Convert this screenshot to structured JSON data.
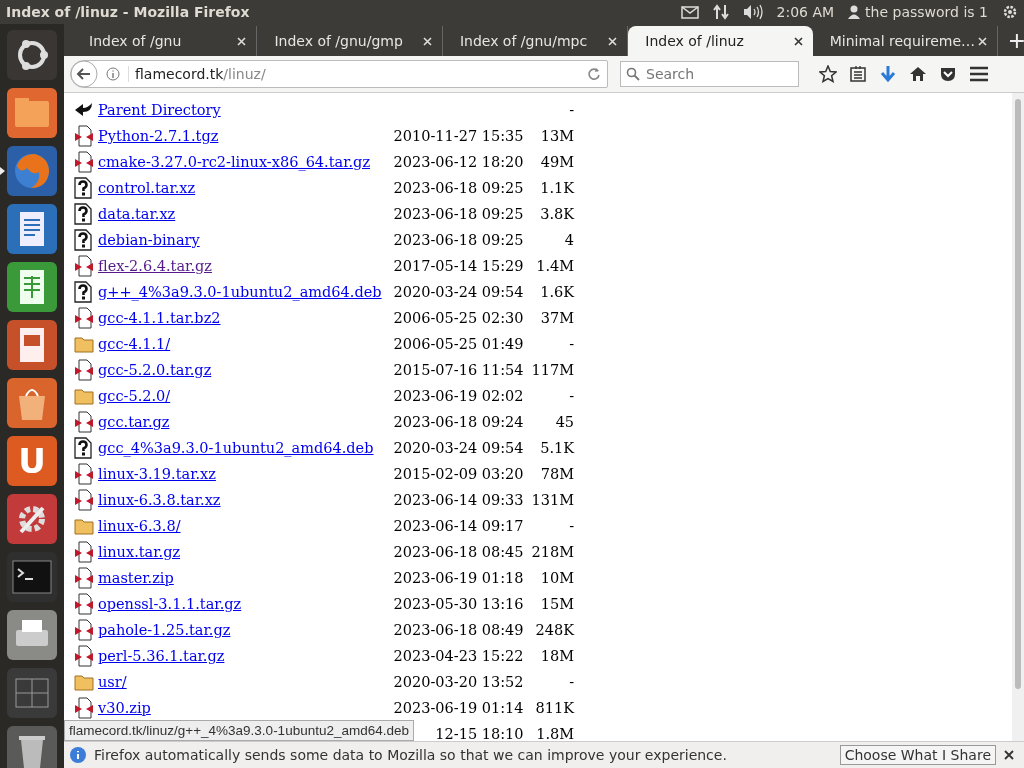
{
  "window": {
    "title": "Index of /linuz - Mozilla Firefox"
  },
  "panel": {
    "clock": "2:06 AM",
    "user": "the password is 1"
  },
  "launcher": [
    {
      "kind": "ubuntu",
      "selected": false
    },
    {
      "kind": "files",
      "selected": false
    },
    {
      "kind": "firefox",
      "selected": true
    },
    {
      "kind": "writer",
      "selected": false
    },
    {
      "kind": "calc",
      "selected": false
    },
    {
      "kind": "impress",
      "selected": false
    },
    {
      "kind": "store",
      "selected": false
    },
    {
      "kind": "letter",
      "label": "U",
      "selected": false
    },
    {
      "kind": "settings",
      "selected": false
    },
    {
      "kind": "terminal",
      "selected": false
    },
    {
      "kind": "printer",
      "selected": false
    },
    {
      "kind": "workspaces",
      "selected": false
    },
    {
      "kind": "trash",
      "selected": false
    }
  ],
  "tabs": [
    {
      "label": "Index of /gnu",
      "selected": false
    },
    {
      "label": "Index of /gnu/gmp",
      "selected": false
    },
    {
      "label": "Index of /gnu/mpc",
      "selected": false
    },
    {
      "label": "Index of /linuz",
      "selected": true
    },
    {
      "label": "Minimal requireme…",
      "selected": false
    }
  ],
  "address": {
    "host": "flamecord.tk",
    "path": "/linuz/"
  },
  "search": {
    "placeholder": "Search"
  },
  "listing": [
    {
      "kind": "parent",
      "name": "Parent Directory",
      "size": "-"
    },
    {
      "kind": "archive",
      "name": "Python-2.7.1.tgz",
      "date": "2010-11-27 15:35",
      "size": "13M",
      "visited": false
    },
    {
      "kind": "archive",
      "name": "cmake-3.27.0-rc2-linux-x86_64.tar.gz",
      "date": "2023-06-12 18:20",
      "size": "49M",
      "visited": false
    },
    {
      "kind": "unknown",
      "name": "control.tar.xz",
      "date": "2023-06-18 09:25",
      "size": "1.1K",
      "visited": false
    },
    {
      "kind": "unknown",
      "name": "data.tar.xz",
      "date": "2023-06-18 09:25",
      "size": "3.8K",
      "visited": false
    },
    {
      "kind": "unknown",
      "name": "debian-binary",
      "date": "2023-06-18 09:25",
      "size": "4",
      "visited": false
    },
    {
      "kind": "archive",
      "name": "flex-2.6.4.tar.gz",
      "date": "2017-05-14 15:29",
      "size": "1.4M",
      "visited": true
    },
    {
      "kind": "unknown",
      "name": "g++_4%3a9.3.0-1ubuntu2_amd64.deb",
      "date": "2020-03-24 09:54",
      "size": "1.6K",
      "visited": false
    },
    {
      "kind": "archive",
      "name": "gcc-4.1.1.tar.bz2",
      "date": "2006-05-25 02:30",
      "size": "37M",
      "visited": false
    },
    {
      "kind": "folder",
      "name": "gcc-4.1.1/",
      "date": "2006-05-25 01:49",
      "size": "-",
      "visited": false
    },
    {
      "kind": "archive",
      "name": "gcc-5.2.0.tar.gz",
      "date": "2015-07-16 11:54",
      "size": "117M",
      "visited": false
    },
    {
      "kind": "folder",
      "name": "gcc-5.2.0/",
      "date": "2023-06-19 02:02",
      "size": "-",
      "visited": false
    },
    {
      "kind": "archive",
      "name": "gcc.tar.gz",
      "date": "2023-06-18 09:24",
      "size": "45",
      "visited": false
    },
    {
      "kind": "unknown",
      "name": "gcc_4%3a9.3.0-1ubuntu2_amd64.deb",
      "date": "2020-03-24 09:54",
      "size": "5.1K",
      "visited": false
    },
    {
      "kind": "archive",
      "name": "linux-3.19.tar.xz",
      "date": "2015-02-09 03:20",
      "size": "78M",
      "visited": false
    },
    {
      "kind": "archive",
      "name": "linux-6.3.8.tar.xz",
      "date": "2023-06-14 09:33",
      "size": "131M",
      "visited": false
    },
    {
      "kind": "folder",
      "name": "linux-6.3.8/",
      "date": "2023-06-14 09:17",
      "size": "-",
      "visited": false
    },
    {
      "kind": "archive",
      "name": "linux.tar.gz",
      "date": "2023-06-18 08:45",
      "size": "218M",
      "visited": false
    },
    {
      "kind": "archive",
      "name": "master.zip",
      "date": "2023-06-19 01:18",
      "size": "10M",
      "visited": false
    },
    {
      "kind": "archive",
      "name": "openssl-3.1.1.tar.gz",
      "date": "2023-05-30 13:16",
      "size": "15M",
      "visited": false
    },
    {
      "kind": "archive",
      "name": "pahole-1.25.tar.gz",
      "date": "2023-06-18 08:49",
      "size": "248K",
      "visited": false
    },
    {
      "kind": "archive",
      "name": "perl-5.36.1.tar.gz",
      "date": "2023-04-23 15:22",
      "size": "18M",
      "visited": false
    },
    {
      "kind": "folder",
      "name": "usr/",
      "date": "2020-03-20 13:52",
      "size": "-",
      "visited": false
    },
    {
      "kind": "archive",
      "name": "v30.zip",
      "date": "2023-06-19 01:14",
      "size": "811K",
      "visited": false
    },
    {
      "kind": "hidden",
      "date": "12-15 18:10",
      "size": "1.8M"
    }
  ],
  "status_tooltip": "flamecord.tk/linuz/g++_4%3a9.3.0-1ubuntu2_amd64.deb",
  "notification": {
    "message": "Firefox automatically sends some data to Mozilla so that we can improve your experience.",
    "button": "Choose What I Share"
  }
}
